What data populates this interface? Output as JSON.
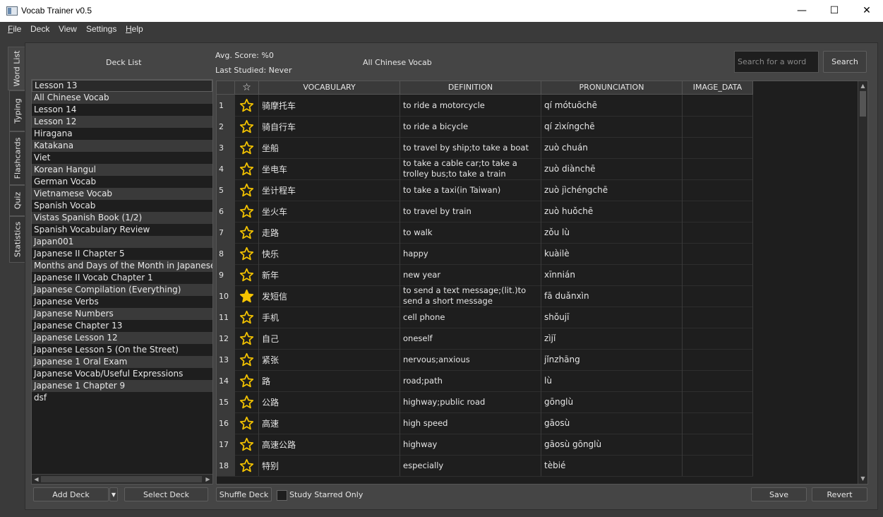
{
  "window": {
    "title": "Vocab Trainer v0.5",
    "min": "—",
    "max": "☐",
    "close": "✕"
  },
  "menu": [
    {
      "pre": "",
      "ul": "F",
      "post": "ile"
    },
    {
      "pre": "Deck",
      "ul": "",
      "post": ""
    },
    {
      "pre": "View",
      "ul": "",
      "post": ""
    },
    {
      "pre": "Settings",
      "ul": "",
      "post": ""
    },
    {
      "pre": "",
      "ul": "H",
      "post": "elp"
    }
  ],
  "side_tabs": [
    "Word List",
    "Typing",
    "Flashcards",
    "Quiz",
    "Statistics"
  ],
  "header": {
    "deck_list_label": "Deck List",
    "avg_score": "Avg. Score: %0",
    "last_studied": "Last Studied: Never",
    "current_deck": "All Chinese Vocab",
    "search_placeholder": "Search for a word",
    "search_button": "Search"
  },
  "decks": [
    "Lesson 13",
    "All Chinese Vocab",
    "Lesson 14",
    "Lesson 12",
    "Hiragana",
    "Katakana",
    "Viet",
    "Korean Hangul",
    "German Vocab",
    "Vietnamese Vocab",
    "Spanish Vocab",
    "Vistas Spanish Book (1/2)",
    "Spanish Vocabulary Review",
    "Japan001",
    "Japanese II Chapter 5",
    "Months and Days of the Month in Japanese",
    "Japanese II Vocab Chapter 1",
    "Japanese Compilation (Everything)",
    "Japanese Verbs",
    "Japanese Numbers",
    "Japanese Chapter 13",
    "Japanese Lesson 12",
    "Japanese Lesson 5 (On the Street)",
    "Japanese 1 Oral Exam",
    "Japanese Vocab/Useful Expressions",
    "Japanese 1 Chapter 9",
    "dsf"
  ],
  "table": {
    "headers": {
      "star": "☆",
      "vocab": "VOCABULARY",
      "def": "DEFINITION",
      "pron": "PRONUNCIATION",
      "img": "IMAGE_DATA"
    },
    "rows": [
      {
        "n": "1",
        "starred": false,
        "vocab": "骑摩托车",
        "def": "to ride a motorcycle",
        "pron": "qí mótuōchē"
      },
      {
        "n": "2",
        "starred": false,
        "vocab": "骑自行车",
        "def": "to ride a bicycle",
        "pron": "qí zìxíngchē"
      },
      {
        "n": "3",
        "starred": false,
        "vocab": "坐船",
        "def": "to travel by ship;to take a boat",
        "pron": "zuò chuán"
      },
      {
        "n": "4",
        "starred": false,
        "vocab": "坐电车",
        "def": "to take a cable car;to take a trolley bus;to take a train",
        "pron": "zuò diànchē"
      },
      {
        "n": "5",
        "starred": false,
        "vocab": "坐计程车",
        "def": "to take a taxi(in Taiwan)",
        "pron": "zuò jìchéngchē"
      },
      {
        "n": "6",
        "starred": false,
        "vocab": "坐火车",
        "def": "to travel by train",
        "pron": "zuò huǒchē"
      },
      {
        "n": "7",
        "starred": false,
        "vocab": "走路",
        "def": "to walk",
        "pron": "zǒu lù"
      },
      {
        "n": "8",
        "starred": false,
        "vocab": "快乐",
        "def": "happy",
        "pron": "kuàilè"
      },
      {
        "n": "9",
        "starred": false,
        "vocab": "新年",
        "def": "new year",
        "pron": "xīnnián"
      },
      {
        "n": "10",
        "starred": true,
        "vocab": "发短信",
        "def": "to send a text message;(lit.)to send a short message",
        "pron": "fā duǎnxìn"
      },
      {
        "n": "11",
        "starred": false,
        "vocab": "手机",
        "def": "cell phone",
        "pron": "shǒujī"
      },
      {
        "n": "12",
        "starred": false,
        "vocab": "自己",
        "def": "oneself",
        "pron": "zìjǐ"
      },
      {
        "n": "13",
        "starred": false,
        "vocab": "紧张",
        "def": "nervous;anxious",
        "pron": "jǐnzhāng"
      },
      {
        "n": "14",
        "starred": false,
        "vocab": "路",
        "def": "road;path",
        "pron": "lù"
      },
      {
        "n": "15",
        "starred": false,
        "vocab": "公路",
        "def": "highway;public road",
        "pron": "gōnglù"
      },
      {
        "n": "16",
        "starred": false,
        "vocab": "高速",
        "def": "high speed",
        "pron": "gāosù"
      },
      {
        "n": "17",
        "starred": false,
        "vocab": "高速公路",
        "def": "highway",
        "pron": "gāosù gōnglù"
      },
      {
        "n": "18",
        "starred": false,
        "vocab": "特别",
        "def": "especially",
        "pron": "tèbié"
      }
    ]
  },
  "footer": {
    "add_deck": "Add Deck",
    "select_deck": "Select Deck",
    "shuffle_deck": "Shuffle Deck",
    "study_starred": "Study Starred Only",
    "save": "Save",
    "revert": "Revert"
  },
  "colors": {
    "star": "#f5c400",
    "background": "#3a3a3a",
    "list_bg": "#1e1e1e"
  }
}
